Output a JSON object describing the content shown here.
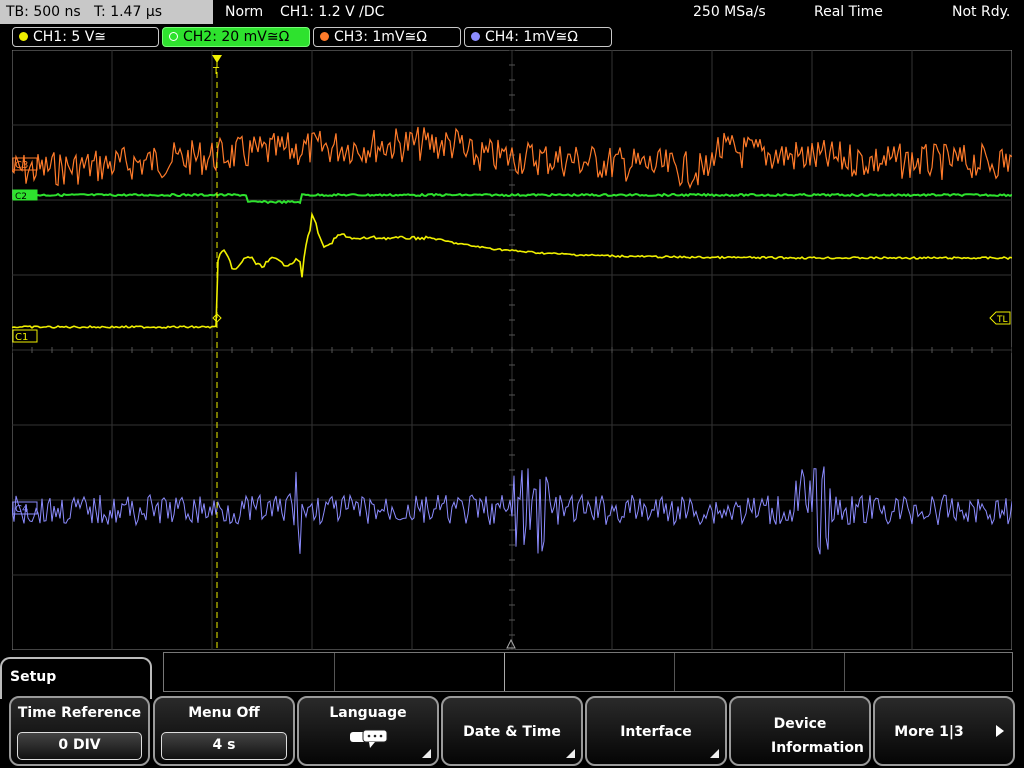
{
  "status": {
    "timebase": "TB: 500 ns   T: 1.47 µs",
    "mode": "Norm",
    "trigger": "CH1: 1.2 V ∕DC",
    "sample_rate": "250 MSa/s",
    "acq_mode": "Real Time",
    "state": "Not Rdy."
  },
  "channels": [
    {
      "label": "CH1: 5 V≅",
      "color": "#f0f000"
    },
    {
      "label": "CH2: 20 mV≅Ω",
      "color": "#2ee22e"
    },
    {
      "label": "CH3: 1mV≅Ω",
      "color": "#ff7b2a"
    },
    {
      "label": "CH4: 1mV≅Ω",
      "color": "#8c8cff"
    }
  ],
  "markers": {
    "c3": "C3",
    "c2": "C2",
    "c1": "C1",
    "c4": "C4",
    "tl": "TL",
    "trig": "T"
  },
  "menu": {
    "title": "Setup",
    "softkeys": [
      {
        "label": "Time Reference",
        "value": "0 DIV"
      },
      {
        "label": "Menu Off",
        "value": "4 s"
      },
      {
        "label": "Language",
        "icon": "speech-bubble-icon"
      },
      {
        "label": "Date & Time"
      },
      {
        "label": "Interface"
      },
      {
        "label": "Device Information"
      },
      {
        "label": "More 1|3"
      }
    ]
  }
}
